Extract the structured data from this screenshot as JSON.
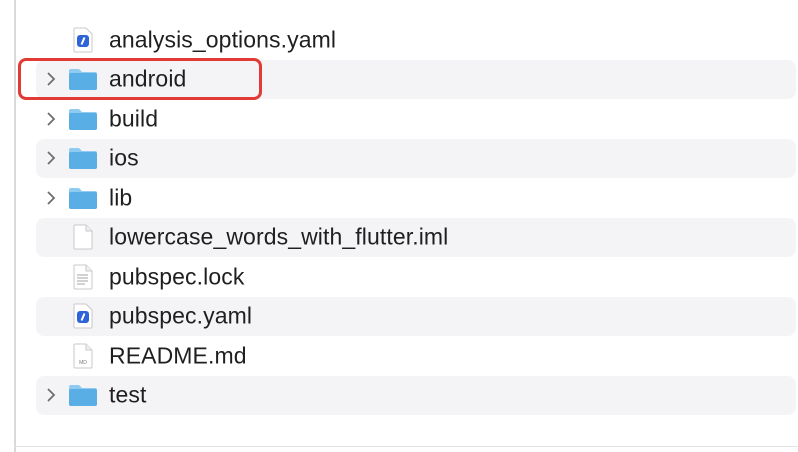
{
  "files": [
    {
      "name": "analysis_options.yaml",
      "kind": "yaml",
      "expandable": false,
      "alt": false
    },
    {
      "name": "android",
      "kind": "folder",
      "expandable": true,
      "alt": true
    },
    {
      "name": "build",
      "kind": "folder",
      "expandable": true,
      "alt": false
    },
    {
      "name": "ios",
      "kind": "folder",
      "expandable": true,
      "alt": true
    },
    {
      "name": "lib",
      "kind": "folder",
      "expandable": true,
      "alt": false
    },
    {
      "name": "lowercase_words_with_flutter.iml",
      "kind": "document",
      "expandable": false,
      "alt": true
    },
    {
      "name": "pubspec.lock",
      "kind": "text",
      "expandable": false,
      "alt": false
    },
    {
      "name": "pubspec.yaml",
      "kind": "yaml",
      "expandable": false,
      "alt": true
    },
    {
      "name": "README.md",
      "kind": "markdown",
      "expandable": false,
      "alt": false
    },
    {
      "name": "test",
      "kind": "folder",
      "expandable": true,
      "alt": true
    }
  ],
  "icons": {
    "folder": "folder-icon",
    "yaml": "yaml-file-icon",
    "document": "document-icon",
    "text": "text-file-icon",
    "markdown": "markdown-file-icon",
    "chevron": "chevron-right-icon"
  },
  "markdown_badge": "MD",
  "highlight": {
    "target": "android",
    "color": "#e23b35"
  },
  "colors": {
    "folder": "#5aaee6",
    "folder_tab": "#8fcbf0",
    "yaml_badge": "#2f63d8",
    "row_alt": "#f4f4f6",
    "text": "#1f1f1f"
  }
}
